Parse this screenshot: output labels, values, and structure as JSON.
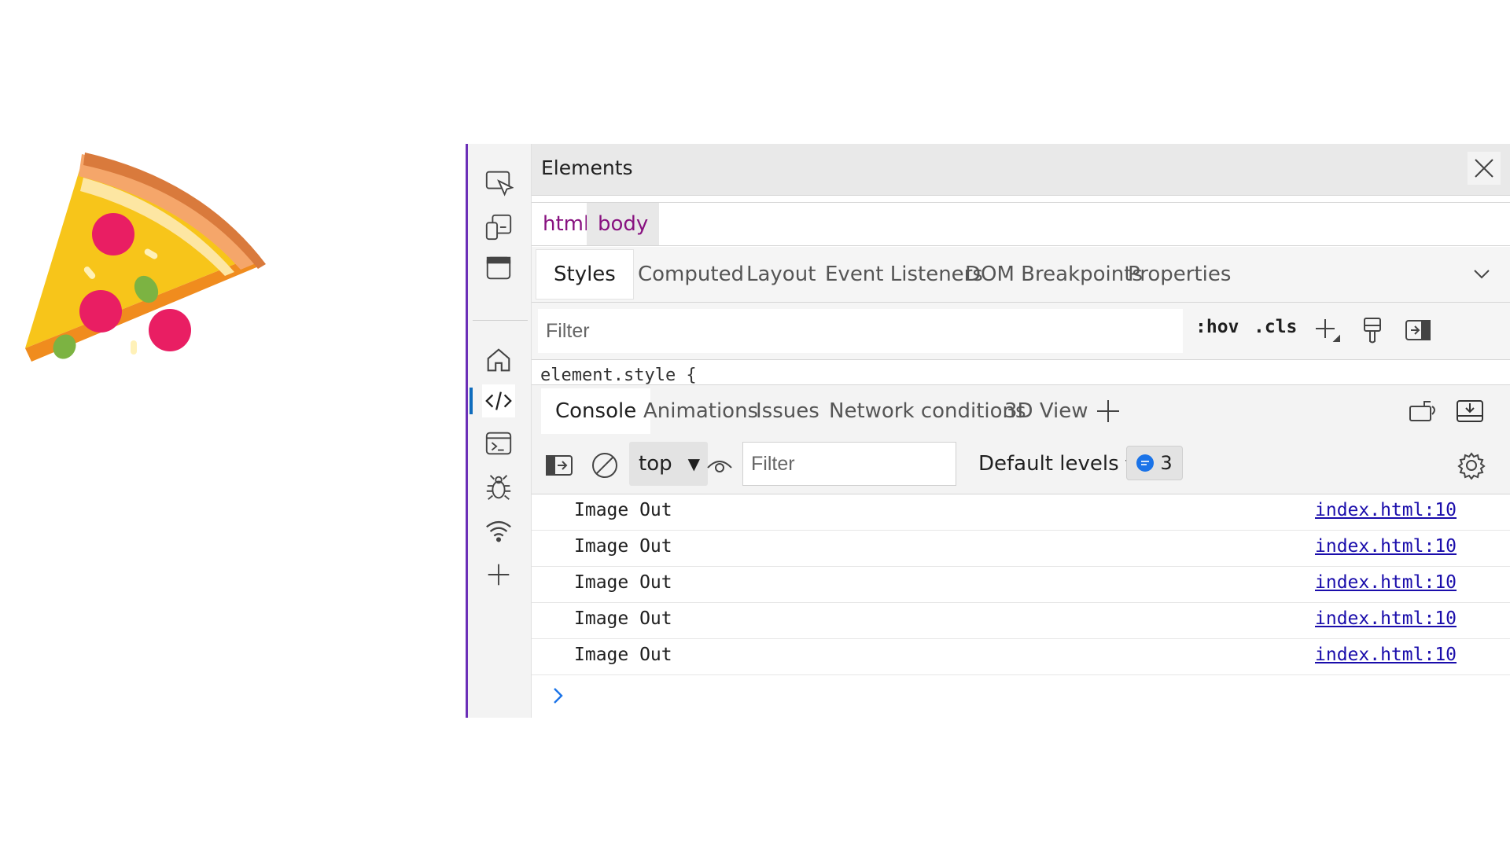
{
  "elements_panel": {
    "title": "Elements"
  },
  "breadcrumb": [
    "html",
    "body"
  ],
  "style_tabs": [
    "Styles",
    "Computed",
    "Layout",
    "Event Listeners",
    "DOM Breakpoints",
    "Properties"
  ],
  "style_filter": {
    "placeholder": "Filter",
    "hov": ":hov",
    "cls": ".cls"
  },
  "element_style": "element.style {",
  "drawer_tabs": [
    "Console",
    "Animations",
    "Issues",
    "Network conditions",
    "3D View"
  ],
  "console_toolbar": {
    "context": "top",
    "filter_placeholder": "Filter",
    "levels": "Default levels",
    "message_count": "3"
  },
  "console_messages": [
    {
      "text": "Image Out",
      "source": "index.html:10"
    },
    {
      "text": "Image Out",
      "source": "index.html:10"
    },
    {
      "text": "Image Out",
      "source": "index.html:10"
    },
    {
      "text": "Image Out",
      "source": "index.html:10"
    },
    {
      "text": "Image Out",
      "source": "index.html:10"
    }
  ],
  "colors": {
    "accent": "#6b2fb7",
    "link": "#1a0dab",
    "dom_tag": "#881280",
    "info": "#1a73e8"
  }
}
